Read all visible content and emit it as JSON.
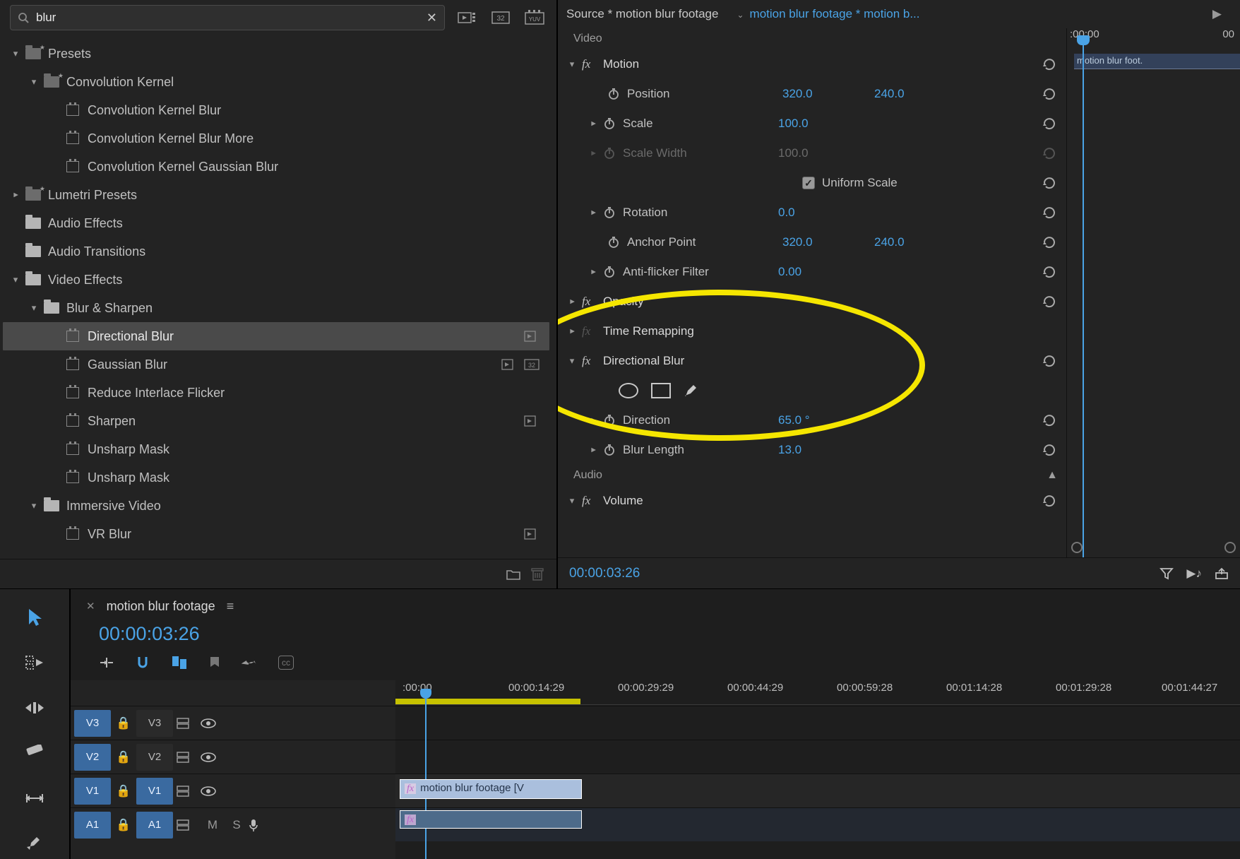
{
  "effects": {
    "search": {
      "placeholder": "",
      "value": "blur"
    },
    "toolbar": {
      "icon1": "timeline-preset-icon",
      "icon2": "32",
      "icon3": "yuv-icon"
    },
    "tree": {
      "presets": "Presets",
      "convKernel": "Convolution Kernel",
      "ckBlur": "Convolution Kernel Blur",
      "ckBlurMore": "Convolution Kernel Blur More",
      "ckGauss": "Convolution Kernel Gaussian Blur",
      "lumetri": "Lumetri Presets",
      "audioFx": "Audio Effects",
      "audioTr": "Audio Transitions",
      "videoFx": "Video Effects",
      "blurSharpen": "Blur & Sharpen",
      "dirBlur": "Directional Blur",
      "gaussBlur": "Gaussian Blur",
      "reduceFlicker": "Reduce Interlace Flicker",
      "sharpen": "Sharpen",
      "unsharp1": "Unsharp Mask",
      "unsharp2": "Unsharp Mask",
      "immersive": "Immersive Video",
      "vrBlur": "VR Blur"
    }
  },
  "ec": {
    "source": "Source * motion blur footage",
    "clip": "motion blur footage * motion b...",
    "mini_tl_clip": "motion blur foot.",
    "mini_ruler": {
      "t0": ":00:00",
      "t1": "00"
    },
    "sectionVideo": "Video",
    "motion": "Motion",
    "position": {
      "label": "Position",
      "x": "320.0",
      "y": "240.0"
    },
    "scale": {
      "label": "Scale",
      "v": "100.0"
    },
    "scaleW": {
      "label": "Scale Width",
      "v": "100.0"
    },
    "uniform": "Uniform Scale",
    "rotation": {
      "label": "Rotation",
      "v": "0.0"
    },
    "anchor": {
      "label": "Anchor Point",
      "x": "320.0",
      "y": "240.0"
    },
    "antiflicker": {
      "label": "Anti-flicker Filter",
      "v": "0.00"
    },
    "opacity": "Opacity",
    "timeremap": "Time Remapping",
    "dirBlur": "Directional Blur",
    "direction": {
      "label": "Direction",
      "v": "65.0 °"
    },
    "blurLength": {
      "label": "Blur Length",
      "v": "13.0"
    },
    "sectionAudio": "Audio",
    "volume": "Volume",
    "time": "00:00:03:26"
  },
  "timeline": {
    "tab": "motion blur footage",
    "time": "00:00:03:26",
    "ruler": [
      ":00:00",
      "00:00:14:29",
      "00:00:29:29",
      "00:00:44:29",
      "00:00:59:28",
      "00:01:14:28",
      "00:01:29:28",
      "00:01:44:27"
    ],
    "tracks": {
      "v3": "V3",
      "v2": "V2",
      "v1": "V1",
      "a1": "A1",
      "m": "M",
      "s": "S"
    },
    "clipV": "motion blur footage [V",
    "clipA": ""
  }
}
